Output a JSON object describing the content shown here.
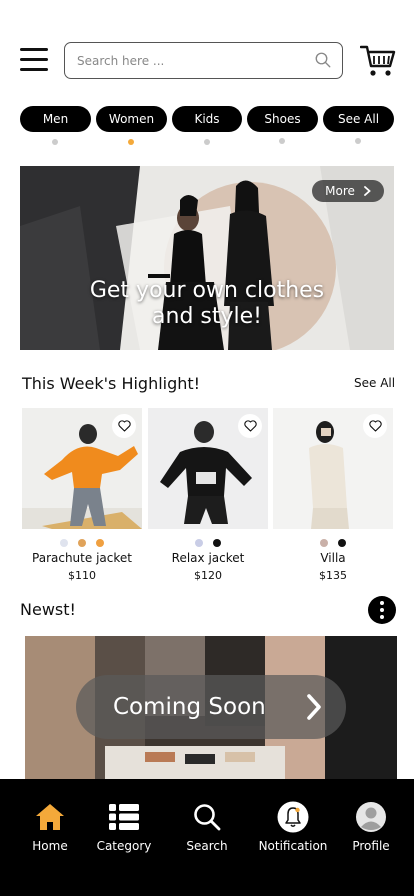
{
  "search": {
    "placeholder": "Search here ...",
    "value": ""
  },
  "categories": [
    {
      "label": "Men",
      "active": false
    },
    {
      "label": "Women",
      "active": true
    },
    {
      "label": "Kids",
      "active": false
    },
    {
      "label": "Shoes",
      "active": false
    },
    {
      "label": "See All",
      "active": false
    }
  ],
  "hero": {
    "more_label": "More",
    "headline_line1": "Get your own clothes",
    "headline_line2": "and style!"
  },
  "highlights": {
    "title": "This Week's Highlight!",
    "see_all": "See All",
    "products": [
      {
        "name": "Parachute jacket",
        "price": "$110",
        "swatches": [
          "#dfe3ee",
          "#e0a35a",
          "#f0a040"
        ]
      },
      {
        "name": "Relax jacket",
        "price": "$120",
        "swatches": [
          "#c9cde6",
          "#111111"
        ]
      },
      {
        "name": "Villa",
        "price": "$135",
        "swatches": [
          "#c9b0a8",
          "#111111"
        ]
      }
    ]
  },
  "newest": {
    "title": "Newst!",
    "banner_label": "Coming Soon"
  },
  "bottom_nav": [
    {
      "label": "Home",
      "icon": "home-icon",
      "active": true
    },
    {
      "label": "Category",
      "icon": "list-icon",
      "active": false
    },
    {
      "label": "Search",
      "icon": "search-icon",
      "active": false
    },
    {
      "label": "Notification",
      "icon": "bell-icon",
      "active": false
    },
    {
      "label": "Profile",
      "icon": "user-icon",
      "active": false
    }
  ],
  "colors": {
    "accent": "#f4a93a",
    "chip_bg": "#000000",
    "nav_bg": "#000000",
    "active_dot": "#f4a93a",
    "inactive_dot": "#cccccc"
  }
}
